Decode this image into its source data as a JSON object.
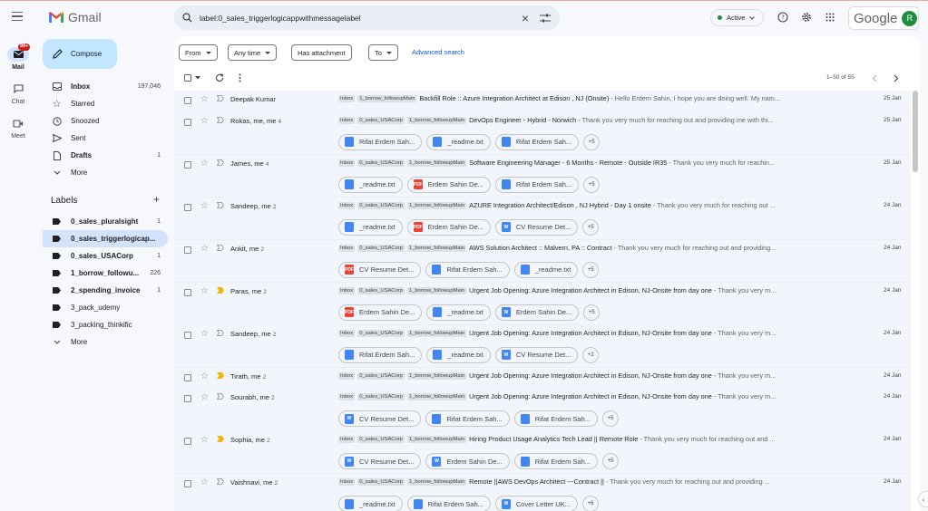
{
  "app": {
    "name": "Gmail"
  },
  "rail": {
    "mail_badge": "99+",
    "items": [
      {
        "label": "Mail"
      },
      {
        "label": "Chat"
      },
      {
        "label": "Meet"
      }
    ]
  },
  "compose_label": "Compose",
  "nav": [
    {
      "label": "Inbox",
      "count": "197,046",
      "icon": "inbox-icon"
    },
    {
      "label": "Starred",
      "count": "",
      "icon": "star-icon"
    },
    {
      "label": "Snoozed",
      "count": "",
      "icon": "clock-icon"
    },
    {
      "label": "Sent",
      "count": "",
      "icon": "send-icon"
    },
    {
      "label": "Drafts",
      "count": "1",
      "icon": "draft-icon"
    },
    {
      "label": "More",
      "count": "",
      "icon": "chevron-down-icon"
    }
  ],
  "labels_title": "Labels",
  "labels": [
    {
      "label": "0_sales_pluralsight",
      "count": "1"
    },
    {
      "label": "0_sales_triggerlogicap...",
      "count": ""
    },
    {
      "label": "0_sales_USACorp",
      "count": "1"
    },
    {
      "label": "1_borrow_followu...",
      "count": "226"
    },
    {
      "label": "2_spending_invoice",
      "count": "1"
    },
    {
      "label": "3_pack_udemy",
      "count": ""
    },
    {
      "label": "3_packing_thinkific",
      "count": ""
    }
  ],
  "labels_more": "More",
  "search": {
    "query": "label:0_sales_triggerlogicappwithmessagelabel"
  },
  "status": {
    "label": "Active"
  },
  "account_initial": "R",
  "google_word": "Google",
  "filters": {
    "from": "From",
    "any_time": "Any time",
    "has_attachment": "Has attachment",
    "to": "To",
    "advanced": "Advanced search"
  },
  "pager": "1–50 of 55",
  "colors": {
    "accent": "#0b57d0",
    "compose_bg": "#c2e7ff",
    "active_nav_bg": "#d3e3fd",
    "active_dot": "#1e8e3e"
  },
  "emails": [
    {
      "sender": "Deepak Kumar",
      "count": "",
      "labels": [
        "Inbox",
        "1_borrow_followupMain"
      ],
      "subject": "Backfill Role :: Azure Integration Architect at Edison , NJ (Onsite)",
      "snippet": " - Hello Erdem Sahin, I hope you are doing well. My nam...",
      "date": "25 Jan",
      "important": false,
      "attachments": [],
      "more": ""
    },
    {
      "sender": "Rokas, me, me",
      "count": "4",
      "labels": [
        "Inbox",
        "0_sales_USACorp",
        "1_borrow_followupMain"
      ],
      "subject": "DevOps Engineer - Hybrid - Norwich",
      "snippet": " - Thank you very much for reaching out and providing me with thi...",
      "date": "25 Jan",
      "important": false,
      "attachments": [
        {
          "type": "doc",
          "name": "Rifat Erdem Sah..."
        },
        {
          "type": "doc",
          "name": "_readme.txt"
        },
        {
          "type": "doc",
          "name": "Rifat Erdem Sah..."
        }
      ],
      "more": "+5"
    },
    {
      "sender": "James, me",
      "count": "4",
      "labels": [
        "Inbox",
        "0_sales_USACorp",
        "1_borrow_followupMain"
      ],
      "subject": "Software Engineering Manager - 6 Months - Remote - Outside IR35",
      "snippet": " - Thank you very much for reachin...",
      "date": "25 Jan",
      "important": false,
      "attachments": [
        {
          "type": "doc",
          "name": "_readme.txt"
        },
        {
          "type": "pdf",
          "name": "Erdem Sahin De..."
        },
        {
          "type": "doc",
          "name": "Rifat Erdem Sah..."
        }
      ],
      "more": "+5"
    },
    {
      "sender": "Sandeep, me",
      "count": "2",
      "labels": [
        "Inbox",
        "0_sales_USACorp",
        "1_borrow_followupMain"
      ],
      "subject": "AZURE Integration Architect/Edison , NJ Hybrid - Day 1 onsite",
      "snippet": " - Thank you very much for reaching out ...",
      "date": "24 Jan",
      "important": false,
      "attachments": [
        {
          "type": "doc",
          "name": "_readme.txt"
        },
        {
          "type": "pdf",
          "name": "Erdem Sahin De..."
        },
        {
          "type": "word",
          "name": "CV Resume Det..."
        }
      ],
      "more": "+5"
    },
    {
      "sender": "Ankit, me",
      "count": "2",
      "labels": [
        "Inbox",
        "0_sales_USACorp",
        "1_borrow_followupMain"
      ],
      "subject": "AWS Solution Architect :: Malvern, PA :: Contract",
      "snippet": " - Thank you very much for reaching out and providing...",
      "date": "24 Jan",
      "important": false,
      "attachments": [
        {
          "type": "pdf",
          "name": "CV Resume Det..."
        },
        {
          "type": "doc",
          "name": "Rifat Erdem Sah..."
        },
        {
          "type": "doc",
          "name": "_readme.txt"
        }
      ],
      "more": "+5"
    },
    {
      "sender": "Paras, me",
      "count": "2",
      "labels": [
        "Inbox",
        "0_sales_USACorp",
        "1_borrow_followupMain"
      ],
      "subject": "Urgent Job Opening: Azure Integration Architect in Edison, NJ-Onsite from day one",
      "snippet": " - Thank you very m...",
      "date": "24 Jan",
      "important": true,
      "attachments": [
        {
          "type": "pdf",
          "name": "Erdem Sahin De..."
        },
        {
          "type": "doc",
          "name": "_readme.txt"
        },
        {
          "type": "word",
          "name": "Erdem Sahin De..."
        }
      ],
      "more": "+5"
    },
    {
      "sender": "Sandeep, me",
      "count": "2",
      "labels": [
        "Inbox",
        "0_sales_USACorp",
        "1_borrow_followupMain"
      ],
      "subject": "Urgent Job Opening: Azure Integration Architect in Edison, NJ-Onsite from day one",
      "snippet": " - Thank you very m...",
      "date": "24 Jan",
      "important": false,
      "attachments": [
        {
          "type": "doc",
          "name": "Rifat Erdem Sah..."
        },
        {
          "type": "doc",
          "name": "_readme.txt"
        },
        {
          "type": "word",
          "name": "CV Resume Det..."
        }
      ],
      "more": "+2"
    },
    {
      "sender": "Tirath, me",
      "count": "2",
      "labels": [
        "Inbox",
        "0_sales_USACorp",
        "1_borrow_followupMain"
      ],
      "subject": "Urgent Job Opening: Azure Integration Architect in Edison, NJ-Onsite from day one",
      "snippet": " - Thank you very m...",
      "date": "24 Jan",
      "important": true,
      "attachments": [],
      "more": ""
    },
    {
      "sender": "Sourabh, me",
      "count": "2",
      "labels": [
        "Inbox",
        "0_sales_USACorp",
        "1_borrow_followupMain"
      ],
      "subject": "Urgent Job Opening: Azure Integration Architect in Edison, NJ-Onsite from day one",
      "snippet": " - Thank you very m...",
      "date": "24 Jan",
      "important": false,
      "attachments": [
        {
          "type": "word",
          "name": "CV Resume Det..."
        },
        {
          "type": "doc",
          "name": "Rifat Erdem Sah..."
        },
        {
          "type": "doc",
          "name": "Rifat Erdem Sah..."
        }
      ],
      "more": "+5"
    },
    {
      "sender": "Sophia, me",
      "count": "2",
      "labels": [
        "Inbox",
        "0_sales_USACorp",
        "1_borrow_followupMain"
      ],
      "subject": "Hiring Product Usage Analytics Tech Lead || Remote Role",
      "snippet": " - Thank you very much for reaching out and ...",
      "date": "24 Jan",
      "important": true,
      "attachments": [
        {
          "type": "word",
          "name": "CV Resume Det..."
        },
        {
          "type": "word",
          "name": "Erdem Sahin De..."
        },
        {
          "type": "doc",
          "name": "Rifat Erdem Sah..."
        }
      ],
      "more": "+5"
    },
    {
      "sender": "Vaishnavi, me",
      "count": "2",
      "labels": [
        "Inbox",
        "0_sales_USACorp",
        "1_borrow_followupMain"
      ],
      "subject": "Remote ||AWS DevOps Architect ---Contract ||",
      "snippet": " - Thank you very much for reaching out and providing ...",
      "date": "24 Jan",
      "important": false,
      "attachments": [
        {
          "type": "doc",
          "name": "_readme.txt"
        },
        {
          "type": "doc",
          "name": "Rifat Erdem Sah..."
        },
        {
          "type": "word",
          "name": "Cover Letter UK..."
        }
      ],
      "more": "+6"
    }
  ]
}
